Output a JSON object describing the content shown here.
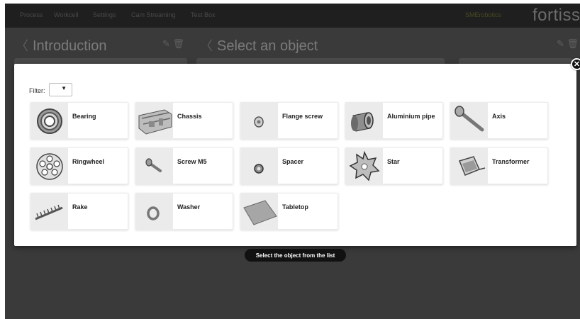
{
  "nav": {
    "items": [
      "Process",
      "Workcell",
      "Settings",
      "Cam Streaming",
      "Test Box"
    ],
    "brand_sub": "SMErobotics",
    "brand": "fortiss"
  },
  "panels": {
    "left_title": "Introduction",
    "right_title": "Select an object",
    "chevron": "〈",
    "tools": "✎ 🗑"
  },
  "modal": {
    "close_glyph": "✕",
    "filter_label": "Filter:",
    "filter_caret": "▼",
    "objects": [
      {
        "label": "Bearing",
        "icon": "bearing-icon"
      },
      {
        "label": "Chassis",
        "icon": "chassis-icon"
      },
      {
        "label": "Flange screw",
        "icon": "flange-screw-icon"
      },
      {
        "label": "Aluminium pipe",
        "icon": "aluminium-pipe-icon"
      },
      {
        "label": "Axis",
        "icon": "axis-icon"
      },
      {
        "label": "Ringwheel",
        "icon": "ringwheel-icon"
      },
      {
        "label": "Screw M5",
        "icon": "screw-icon"
      },
      {
        "label": "Spacer",
        "icon": "spacer-icon"
      },
      {
        "label": "Star",
        "icon": "star-gear-icon"
      },
      {
        "label": "Transformer",
        "icon": "transformer-icon"
      },
      {
        "label": "Rake",
        "icon": "rake-icon"
      },
      {
        "label": "Washer",
        "icon": "washer-icon"
      },
      {
        "label": "Tabletop",
        "icon": "tabletop-icon"
      }
    ]
  },
  "hint": "Select the object from the list"
}
